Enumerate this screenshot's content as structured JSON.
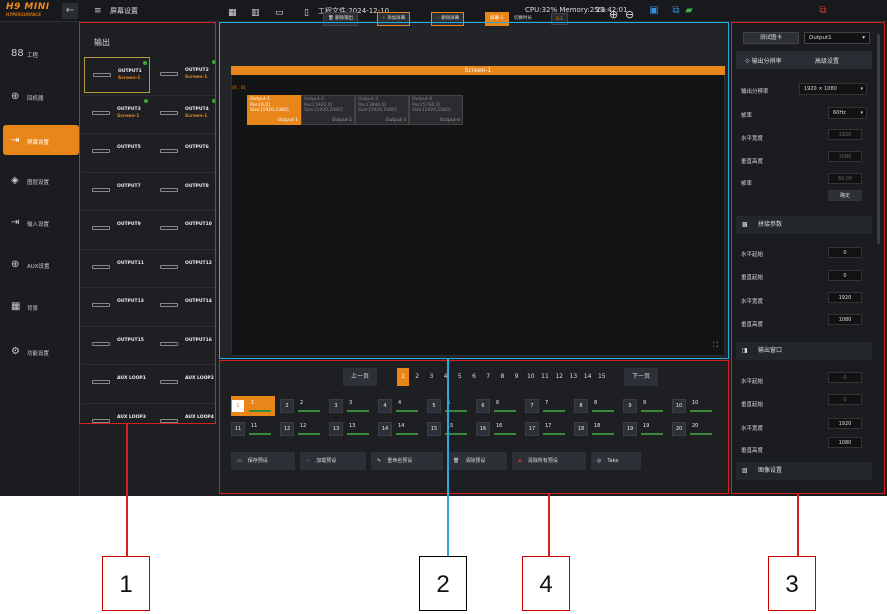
{
  "header": {
    "logo_line1": "H9 MINI",
    "logo_line2": "HYPERSURFACE",
    "back": "←",
    "menu_icon": "≡",
    "title": "屏幕设置",
    "project_file": "工程文件:2024-12-10",
    "cpu_mem": "CPU:32% Memory:25%",
    "time": "13:42:01"
  },
  "sidebar": {
    "items": [
      {
        "icon": "88",
        "label": "工程"
      },
      {
        "icon": "⊕",
        "label": "回机器"
      },
      {
        "icon": "⇥",
        "label": "屏幕设置"
      },
      {
        "icon": "◈",
        "label": "图层设置"
      },
      {
        "icon": "⇥",
        "label": "输入设置"
      },
      {
        "icon": "⊕",
        "label": "AUX设置"
      },
      {
        "icon": "▦",
        "label": "背景"
      },
      {
        "icon": "⚙",
        "label": "功能设置"
      }
    ]
  },
  "outputs": {
    "title": "输出",
    "items": [
      {
        "name": "OUTPUT1",
        "screen": "Screen-1"
      },
      {
        "name": "OUTPUT2",
        "screen": "Screen-1"
      },
      {
        "name": "OUTPUT3",
        "screen": "Screen-1"
      },
      {
        "name": "OUTPUT4",
        "screen": "Screen-1"
      },
      {
        "name": "OUTPUT5",
        "screen": ""
      },
      {
        "name": "OUTPUT6",
        "screen": ""
      },
      {
        "name": "OUTPUT7",
        "screen": ""
      },
      {
        "name": "OUTPUT8",
        "screen": ""
      },
      {
        "name": "OUTPUT9",
        "screen": ""
      },
      {
        "name": "OUTPUT10",
        "screen": ""
      },
      {
        "name": "OUTPUT11",
        "screen": ""
      },
      {
        "name": "OUTPUT12",
        "screen": ""
      },
      {
        "name": "OUTPUT13",
        "screen": ""
      },
      {
        "name": "OUTPUT14",
        "screen": ""
      },
      {
        "name": "OUTPUT15",
        "screen": ""
      },
      {
        "name": "OUTPUT16",
        "screen": ""
      },
      {
        "name": "AUX LOOP1",
        "screen": ""
      },
      {
        "name": "AUX LOOP2",
        "screen": ""
      },
      {
        "name": "AUX LOOP3",
        "screen": ""
      },
      {
        "name": "AUX LOOP4",
        "screen": ""
      }
    ]
  },
  "toolbar": {
    "delete_output": "删除输出",
    "add_screen": "添加屏幕",
    "delete_screen": "删除屏幕",
    "screen_tag": "屏幕-1",
    "switch_time": "切换时长",
    "switch_value": "0.1"
  },
  "canvas": {
    "screen_name": "Screen-1",
    "origin": "(0 , 0)",
    "outputs": [
      {
        "title": "Output-1",
        "pos": "Pos:[0,0]",
        "size": "Size:[1920,1080]",
        "tag": "Output-1"
      },
      {
        "title": "Output-2",
        "pos": "Pos:[1920,0]",
        "size": "Size:[1920,1080]",
        "tag": "Output-2"
      },
      {
        "title": "Output-3",
        "pos": "Pos:[3840,0]",
        "size": "Size:[1920,1080]",
        "tag": "Output-3"
      },
      {
        "title": "Output-4",
        "pos": "Pos:[5760,0]",
        "size": "Size:[1920,1080]",
        "tag": "Output-4"
      }
    ]
  },
  "presets": {
    "prev": "上一页",
    "next": "下一页",
    "pages": [
      "1",
      "2",
      "3",
      "4",
      "5",
      "6",
      "7",
      "8",
      "9",
      "10",
      "11",
      "12",
      "13",
      "14",
      "15"
    ],
    "row1": [
      "1",
      "2",
      "3",
      "4",
      "5",
      "6",
      "7",
      "8",
      "9",
      "10"
    ],
    "row2": [
      "11",
      "12",
      "13",
      "14",
      "15",
      "16",
      "17",
      "18",
      "19",
      "20"
    ],
    "actions": [
      "保存预设",
      "加载预设",
      "重命名预设",
      "清除预设",
      "清除所有预设",
      "Take"
    ]
  },
  "right": {
    "test_card": "测试图卡",
    "output_select": "Output1",
    "tab_resolution": "输出分辨率",
    "tab_advanced": "高级设置",
    "res_label": "输出分辨率",
    "res_value": "1920 × 1080",
    "rate_label": "帧率",
    "rate_value": "60Hz",
    "hw_label": "水平宽度",
    "hw_value": "1920",
    "vh_label": "垂直高度",
    "vh_value": "1080",
    "fr_label": "帧率",
    "fr_value": "60.00",
    "confirm": "确定",
    "splice_title": "拼接参数",
    "sp_hs": "水平起始",
    "sp_hs_v": "0",
    "sp_vs": "垂直起始",
    "sp_vs_v": "0",
    "sp_hw": "水平宽度",
    "sp_hw_v": "1920",
    "sp_vh": "垂直高度",
    "sp_vh_v": "1080",
    "win_title": "输出窗口",
    "w_hs": "水平起始",
    "w_hs_v": "0",
    "w_vs": "垂直起始",
    "w_vs_v": "0",
    "w_hw": "水平宽度",
    "w_hw_v": "1920",
    "w_vh": "垂直高度",
    "w_vh_v": "1080",
    "img_title": "图像设置"
  },
  "callouts": [
    "1",
    "2",
    "4",
    "3"
  ]
}
